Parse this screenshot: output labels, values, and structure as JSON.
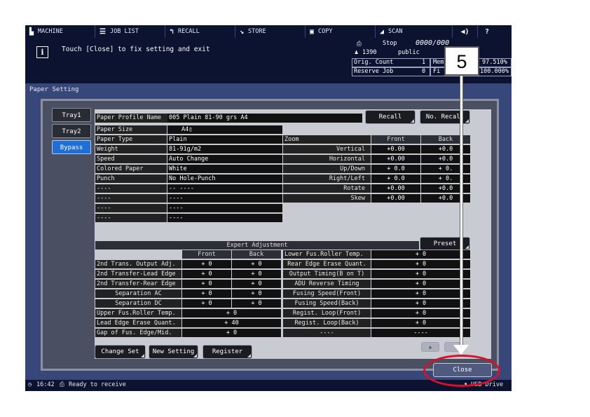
{
  "nav": {
    "machine": "MACHINE",
    "joblist": "JOB LIST",
    "recall": "RECALL",
    "store": "STORE",
    "copy": "COPY",
    "scan": "SCAN",
    "help": "?"
  },
  "message": "Touch [Close] to fix setting and exit",
  "status": {
    "stop": "Stop",
    "counter": "0000/000",
    "user_num": "1390",
    "user": "public",
    "orig_label": "Orig. Count",
    "orig_val": "1",
    "reserve_label": "Reserve Job",
    "reserve_val": "0",
    "mem_label": "Mem",
    "mem_val": "97.510%",
    "file_label": "Fi",
    "file_val": "100.000%"
  },
  "panel_title": "Paper Setting",
  "tabs": [
    "Tray1",
    "Tray2",
    "Bypass"
  ],
  "profile": {
    "label": "Paper Profile Name",
    "value": "005 Plain 81-90 grs A4"
  },
  "buttons": {
    "recall": "Recall",
    "no_recall": "No. Recall",
    "preset": "Preset",
    "change_set": "Change Set",
    "new_setting": "New Setting",
    "register": "Register",
    "close": "Close",
    "up": "▲"
  },
  "paper_rows": [
    [
      "Paper Size",
      "A4▯"
    ],
    [
      "Paper Type",
      "Plain"
    ],
    [
      "Weight",
      "81-91g/m2"
    ],
    [
      "Speed",
      "Auto Change"
    ],
    [
      "Colored Paper",
      "White"
    ],
    [
      "Punch",
      "No Hole-Punch"
    ],
    [
      "----",
      "--  ----"
    ],
    [
      "----",
      "----"
    ],
    [
      "----",
      "----"
    ],
    [
      "----",
      "----"
    ]
  ],
  "zoom": {
    "label": "Zoom",
    "front": "Front",
    "back": "Back",
    "rows": [
      [
        "Vertical",
        "+0.00",
        "+0.0"
      ],
      [
        "Horizontal",
        "+0.00",
        "+0.0"
      ],
      [
        "Up/Down",
        "+ 0.0",
        "+ 0."
      ],
      [
        "Right/Left",
        "+ 0.0",
        "+ 0."
      ],
      [
        "Rotate",
        "+0.00",
        "+0.0"
      ],
      [
        "Skew",
        "+0.00",
        "+0.0"
      ]
    ]
  },
  "expert": {
    "title": "Expert Adjustment",
    "front": "Front",
    "back": "Back",
    "left_rows": [
      [
        "2nd Trans. Output Adj.",
        "+  0",
        "+  0"
      ],
      [
        "2nd Transfer-Lead Edge",
        "+  0",
        "+  0"
      ],
      [
        "2nd Transfer-Rear Edge",
        "+  0",
        "+  0"
      ],
      [
        "Separation AC",
        "+  0",
        "+  0"
      ],
      [
        "Separation DC",
        "+  0",
        "+  0"
      ],
      [
        "Upper Fus.Roller Temp.",
        "+  0",
        ""
      ],
      [
        "Lead Edge Erase Quant.",
        "+ 40",
        ""
      ],
      [
        "Gap of Fus. Edge/Mid.",
        "+  0",
        ""
      ]
    ],
    "right_rows": [
      [
        "Lower Fus.Roller Temp.",
        "+  0"
      ],
      [
        "Rear Edge Erase Quant.",
        "+  0"
      ],
      [
        "Output Timing(B on T)",
        "+  0"
      ],
      [
        "ADU Reverse Timing",
        "+  0"
      ],
      [
        "Fusing Speed(Front)",
        "+  0"
      ],
      [
        "Fusing Speed(Back)",
        "+  0"
      ],
      [
        "Regist. Loop(Front)",
        "+  0"
      ],
      [
        "Regist. Loop(Back)",
        "+  0"
      ],
      [
        "----",
        "----"
      ]
    ]
  },
  "bottom": {
    "time": "16:42",
    "status": "Ready to receive",
    "drive": "USB Drive"
  },
  "annotation": {
    "step": "5"
  }
}
